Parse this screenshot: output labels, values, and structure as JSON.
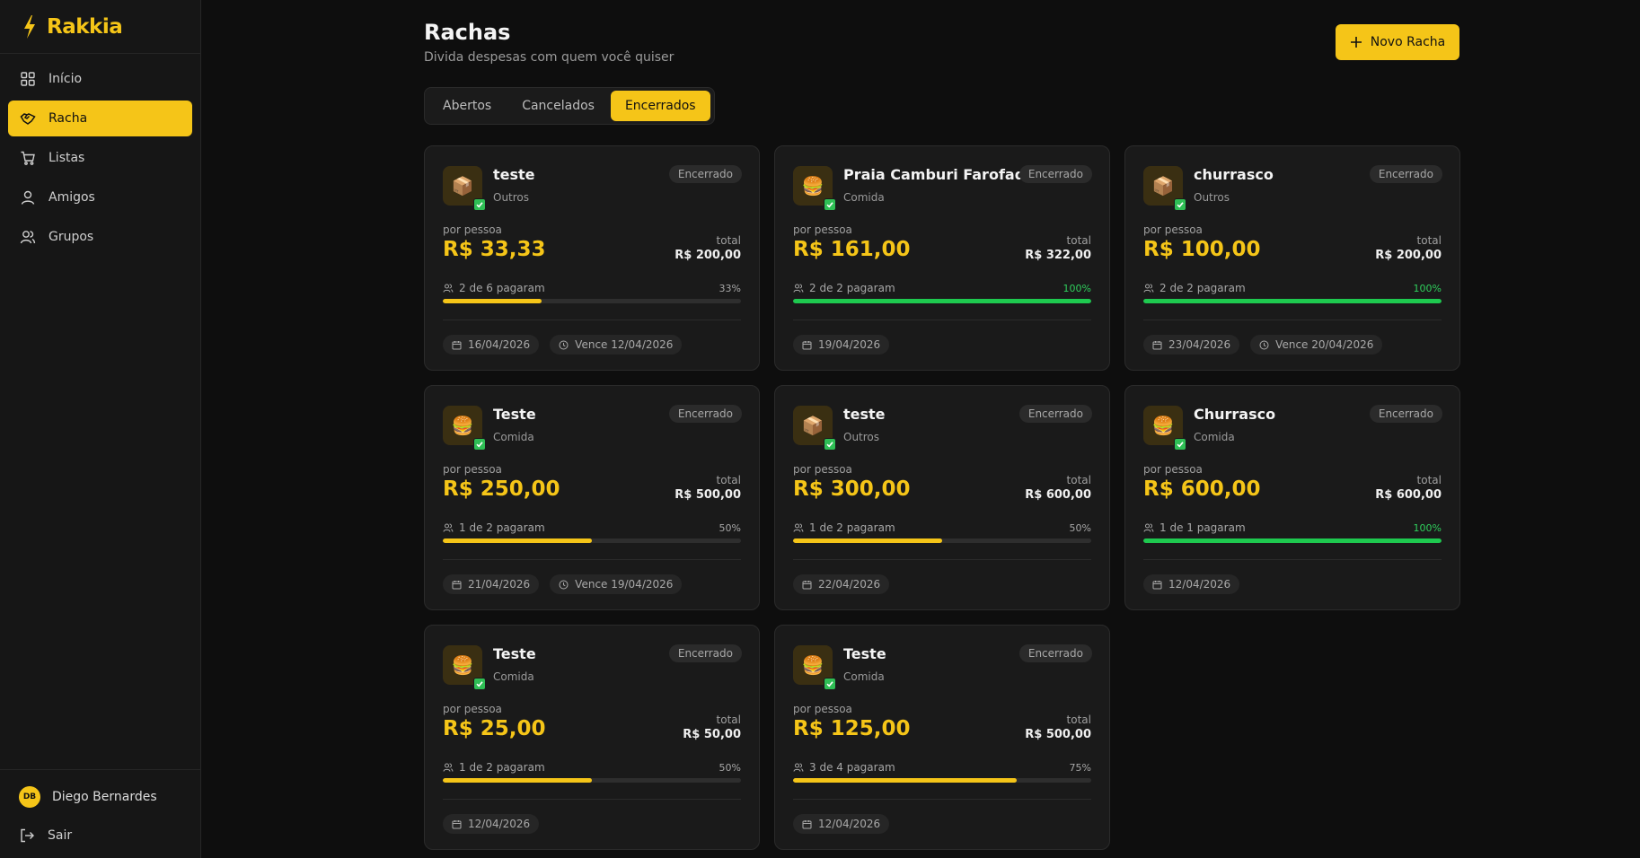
{
  "brand": {
    "name": "Rakkia"
  },
  "sidebar": {
    "items": [
      {
        "label": "Início",
        "icon": "grid-icon",
        "active": false
      },
      {
        "label": "Racha",
        "icon": "handshake-icon",
        "active": true
      },
      {
        "label": "Listas",
        "icon": "cart-icon",
        "active": false
      },
      {
        "label": "Amigos",
        "icon": "user-icon",
        "active": false
      },
      {
        "label": "Grupos",
        "icon": "users-icon",
        "active": false
      }
    ],
    "user": {
      "initials": "DB",
      "name": "Diego Bernardes"
    },
    "logout_label": "Sair"
  },
  "header": {
    "title": "Rachas",
    "subtitle": "Divida despesas com quem você quiser",
    "new_button_label": "Novo Racha"
  },
  "tabs": [
    {
      "label": "Abertos",
      "active": false
    },
    {
      "label": "Cancelados",
      "active": false
    },
    {
      "label": "Encerrados",
      "active": true
    }
  ],
  "card_labels": {
    "per_person": "por pessoa",
    "total": "total"
  },
  "colors": {
    "accent": "#f5c518",
    "success": "#1ec94f",
    "background": "#0e0e0e"
  },
  "cards": [
    {
      "title": "teste",
      "category": "Outros",
      "icon": "package-icon",
      "emoji": "📦",
      "status": "Encerrado",
      "per_person": "R$ 33,33",
      "total": "R$ 200,00",
      "paid_text": "2 de 6 pagaram",
      "percent_label": "33%",
      "progress": 0.33,
      "date": "16/04/2026",
      "due": "Vence 12/04/2026"
    },
    {
      "title": "Praia Camburi Farofada",
      "category": "Comida",
      "icon": "burger-icon",
      "emoji": "🍔",
      "status": "Encerrado",
      "per_person": "R$ 161,00",
      "total": "R$ 322,00",
      "paid_text": "2 de 2 pagaram",
      "percent_label": "100%",
      "progress": 1.0,
      "date": "19/04/2026",
      "due": ""
    },
    {
      "title": "churrasco",
      "category": "Outros",
      "icon": "package-icon",
      "emoji": "📦",
      "status": "Encerrado",
      "per_person": "R$ 100,00",
      "total": "R$ 200,00",
      "paid_text": "2 de 2 pagaram",
      "percent_label": "100%",
      "progress": 1.0,
      "date": "23/04/2026",
      "due": "Vence 20/04/2026"
    },
    {
      "title": "Teste",
      "category": "Comida",
      "icon": "burger-icon",
      "emoji": "🍔",
      "status": "Encerrado",
      "per_person": "R$ 250,00",
      "total": "R$ 500,00",
      "paid_text": "1 de 2 pagaram",
      "percent_label": "50%",
      "progress": 0.5,
      "date": "21/04/2026",
      "due": "Vence 19/04/2026"
    },
    {
      "title": "teste",
      "category": "Outros",
      "icon": "package-icon",
      "emoji": "📦",
      "status": "Encerrado",
      "per_person": "R$ 300,00",
      "total": "R$ 600,00",
      "paid_text": "1 de 2 pagaram",
      "percent_label": "50%",
      "progress": 0.5,
      "date": "22/04/2026",
      "due": ""
    },
    {
      "title": "Churrasco",
      "category": "Comida",
      "icon": "burger-icon",
      "emoji": "🍔",
      "status": "Encerrado",
      "per_person": "R$ 600,00",
      "total": "R$ 600,00",
      "paid_text": "1 de 1 pagaram",
      "percent_label": "100%",
      "progress": 1.0,
      "date": "12/04/2026",
      "due": ""
    },
    {
      "title": "Teste",
      "category": "Comida",
      "icon": "burger-icon",
      "emoji": "🍔",
      "status": "Encerrado",
      "per_person": "R$ 25,00",
      "total": "R$ 50,00",
      "paid_text": "1 de 2 pagaram",
      "percent_label": "50%",
      "progress": 0.5,
      "date": "12/04/2026",
      "due": ""
    },
    {
      "title": "Teste",
      "category": "Comida",
      "icon": "burger-icon",
      "emoji": "🍔",
      "status": "Encerrado",
      "per_person": "R$ 125,00",
      "total": "R$ 500,00",
      "paid_text": "3 de 4 pagaram",
      "percent_label": "75%",
      "progress": 0.75,
      "date": "12/04/2026",
      "due": ""
    }
  ]
}
